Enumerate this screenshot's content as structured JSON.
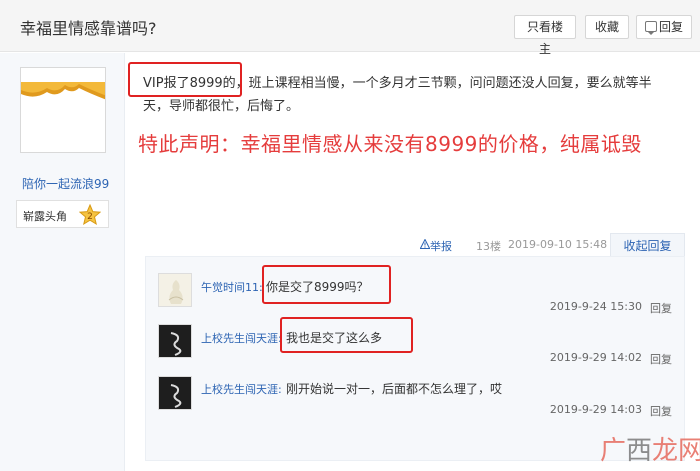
{
  "header": {
    "title": "幸福里情感靠谱吗?",
    "btn_only_op": "只看楼主",
    "btn_collect": "收藏",
    "btn_reply": "回复"
  },
  "author": {
    "name": "陪你一起流浪99",
    "level_label": "崭露头角",
    "level_number": "2"
  },
  "post": {
    "text_vip": "VIP报了8999的",
    "text_line1_rest": "，班上课程相当慢，一个多月才三节颗，问问题还没人回复，要么就等半",
    "text_line2": "天，导师都很忙，后悔了。",
    "notice": "特此声明：幸福里情感从来没有8999的价格，纯属诋毁"
  },
  "meta": {
    "report": "举报",
    "floor": "13楼",
    "date": "2019-09-10 15:48",
    "collapse": "收起回复"
  },
  "comments": [
    {
      "name": "午觉时间11:",
      "text": "你是交了8999吗？",
      "time": "2019-9-24 15:30",
      "reply": "回复"
    },
    {
      "name": "上校先生闯天涯:",
      "text": "我也是交了这么多",
      "time": "2019-9-29 14:02",
      "reply": "回复"
    },
    {
      "name": "上校先生闯天涯:",
      "text": "刚开始说一对一，后面都不怎么理了，哎",
      "time": "2019-9-29 14:03",
      "reply": "回复"
    }
  ],
  "watermark": {
    "left": "广",
    "mid": "西",
    "right": "龙网"
  },
  "colors": {
    "link": "#2d64b3",
    "highlight_box": "#e02222",
    "notice": "#e53c3c"
  }
}
